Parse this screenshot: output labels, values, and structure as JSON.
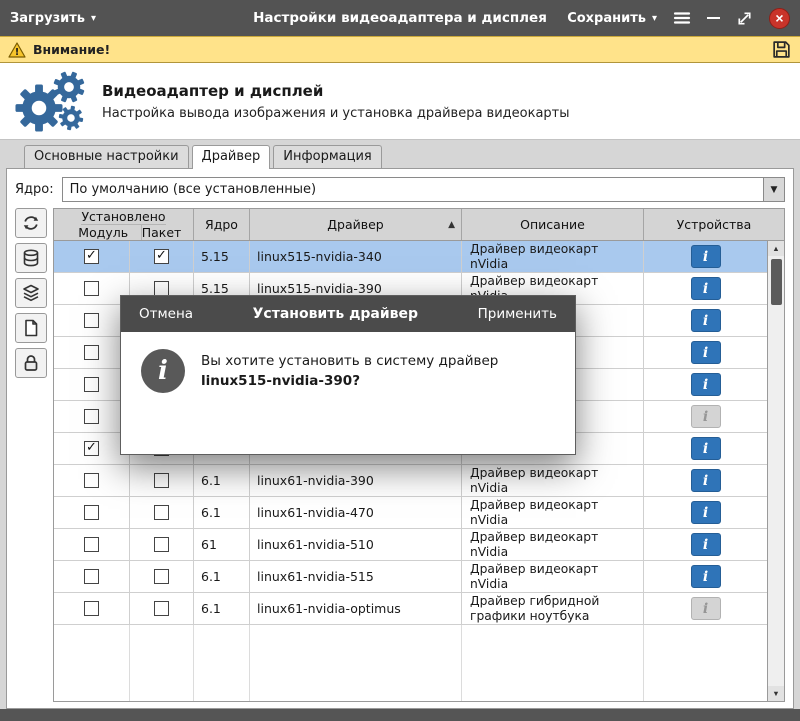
{
  "titlebar": {
    "load_label": "Загрузить",
    "title": "Настройки видеоадаптера и дисплея",
    "save_label": "Сохранить"
  },
  "warning_bar": {
    "label": "Внимание!"
  },
  "header": {
    "title": "Видеоадаптер и дисплей",
    "subtitle": "Настройка вывода изображения и установка драйвера видеокарты"
  },
  "tabs": [
    {
      "label": "Основные настройки",
      "active": false
    },
    {
      "label": "Драйвер",
      "active": true
    },
    {
      "label": "Информация",
      "active": false
    }
  ],
  "kernel": {
    "label": "Ядро:",
    "value": "По умолчанию (все установленные)"
  },
  "table": {
    "group_header": "Установлено",
    "col_module": "Модуль",
    "col_package": "Пакет",
    "col_kernel": "Ядро",
    "col_driver": "Драйвер",
    "col_description": "Описание",
    "col_devices": "Устройства",
    "rows": [
      {
        "selected": true,
        "module": true,
        "pkg": true,
        "kernel": "5.15",
        "driver": "linux515-nvidia-340",
        "desc": "Драйвер видеокарт nVidia",
        "info_disabled": false
      },
      {
        "selected": false,
        "module": false,
        "pkg": false,
        "kernel": "5.15",
        "driver": "linux515-nvidia-390",
        "desc": "Драйвер видеокарт nVidia",
        "info_disabled": false
      },
      {
        "selected": false,
        "module": false,
        "pkg": false,
        "kernel": "",
        "driver": "",
        "desc": "",
        "info_disabled": false
      },
      {
        "selected": false,
        "module": false,
        "pkg": false,
        "kernel": "",
        "driver": "",
        "desc": "",
        "info_disabled": false
      },
      {
        "selected": false,
        "module": false,
        "pkg": false,
        "kernel": "",
        "driver": "",
        "desc": "",
        "info_disabled": false
      },
      {
        "selected": false,
        "module": false,
        "pkg": false,
        "kernel": "",
        "driver": "",
        "desc": "",
        "info_disabled": true
      },
      {
        "selected": false,
        "module": true,
        "pkg": false,
        "kernel": "",
        "driver": "",
        "desc": "",
        "info_disabled": false
      },
      {
        "selected": false,
        "module": false,
        "pkg": false,
        "kernel": "6.1",
        "driver": "linux61-nvidia-390",
        "desc": "Драйвер видеокарт nVidia",
        "info_disabled": false
      },
      {
        "selected": false,
        "module": false,
        "pkg": false,
        "kernel": "6.1",
        "driver": "linux61-nvidia-470",
        "desc": "Драйвер видеокарт nVidia",
        "info_disabled": false
      },
      {
        "selected": false,
        "module": false,
        "pkg": false,
        "kernel": "61",
        "driver": "linux61-nvidia-510",
        "desc": "Драйвер видеокарт nVidia",
        "info_disabled": false
      },
      {
        "selected": false,
        "module": false,
        "pkg": false,
        "kernel": "6.1",
        "driver": "linux61-nvidia-515",
        "desc": "Драйвер видеокарт nVidia",
        "info_disabled": false
      },
      {
        "selected": false,
        "module": false,
        "pkg": false,
        "kernel": "6.1",
        "driver": "linux61-nvidia-optimus",
        "desc": "Драйвер гибридной графики ноутбука",
        "info_disabled": true
      }
    ]
  },
  "dialog": {
    "cancel_label": "Отмена",
    "title": "Установить драйвер",
    "apply_label": "Применить",
    "message": "Вы хотите установить в систему драйвер",
    "driver_name": "linux515-nvidia-390",
    "message_suffix": "?"
  },
  "icons": {
    "info_glyph": "i",
    "sort_asc_glyph": "▲",
    "dropdown_glyph": "▼",
    "scroll_up_glyph": "▲",
    "scroll_down_glyph": "▼",
    "menu_caret_glyph": "▾",
    "close_glyph": "×"
  },
  "colors": {
    "accent_blue": "#2f74b8",
    "selected_row": "#a9c9ee",
    "warning_bg": "#ffe38a",
    "titlebar_bg": "#535353",
    "close_red": "#c9342a"
  }
}
